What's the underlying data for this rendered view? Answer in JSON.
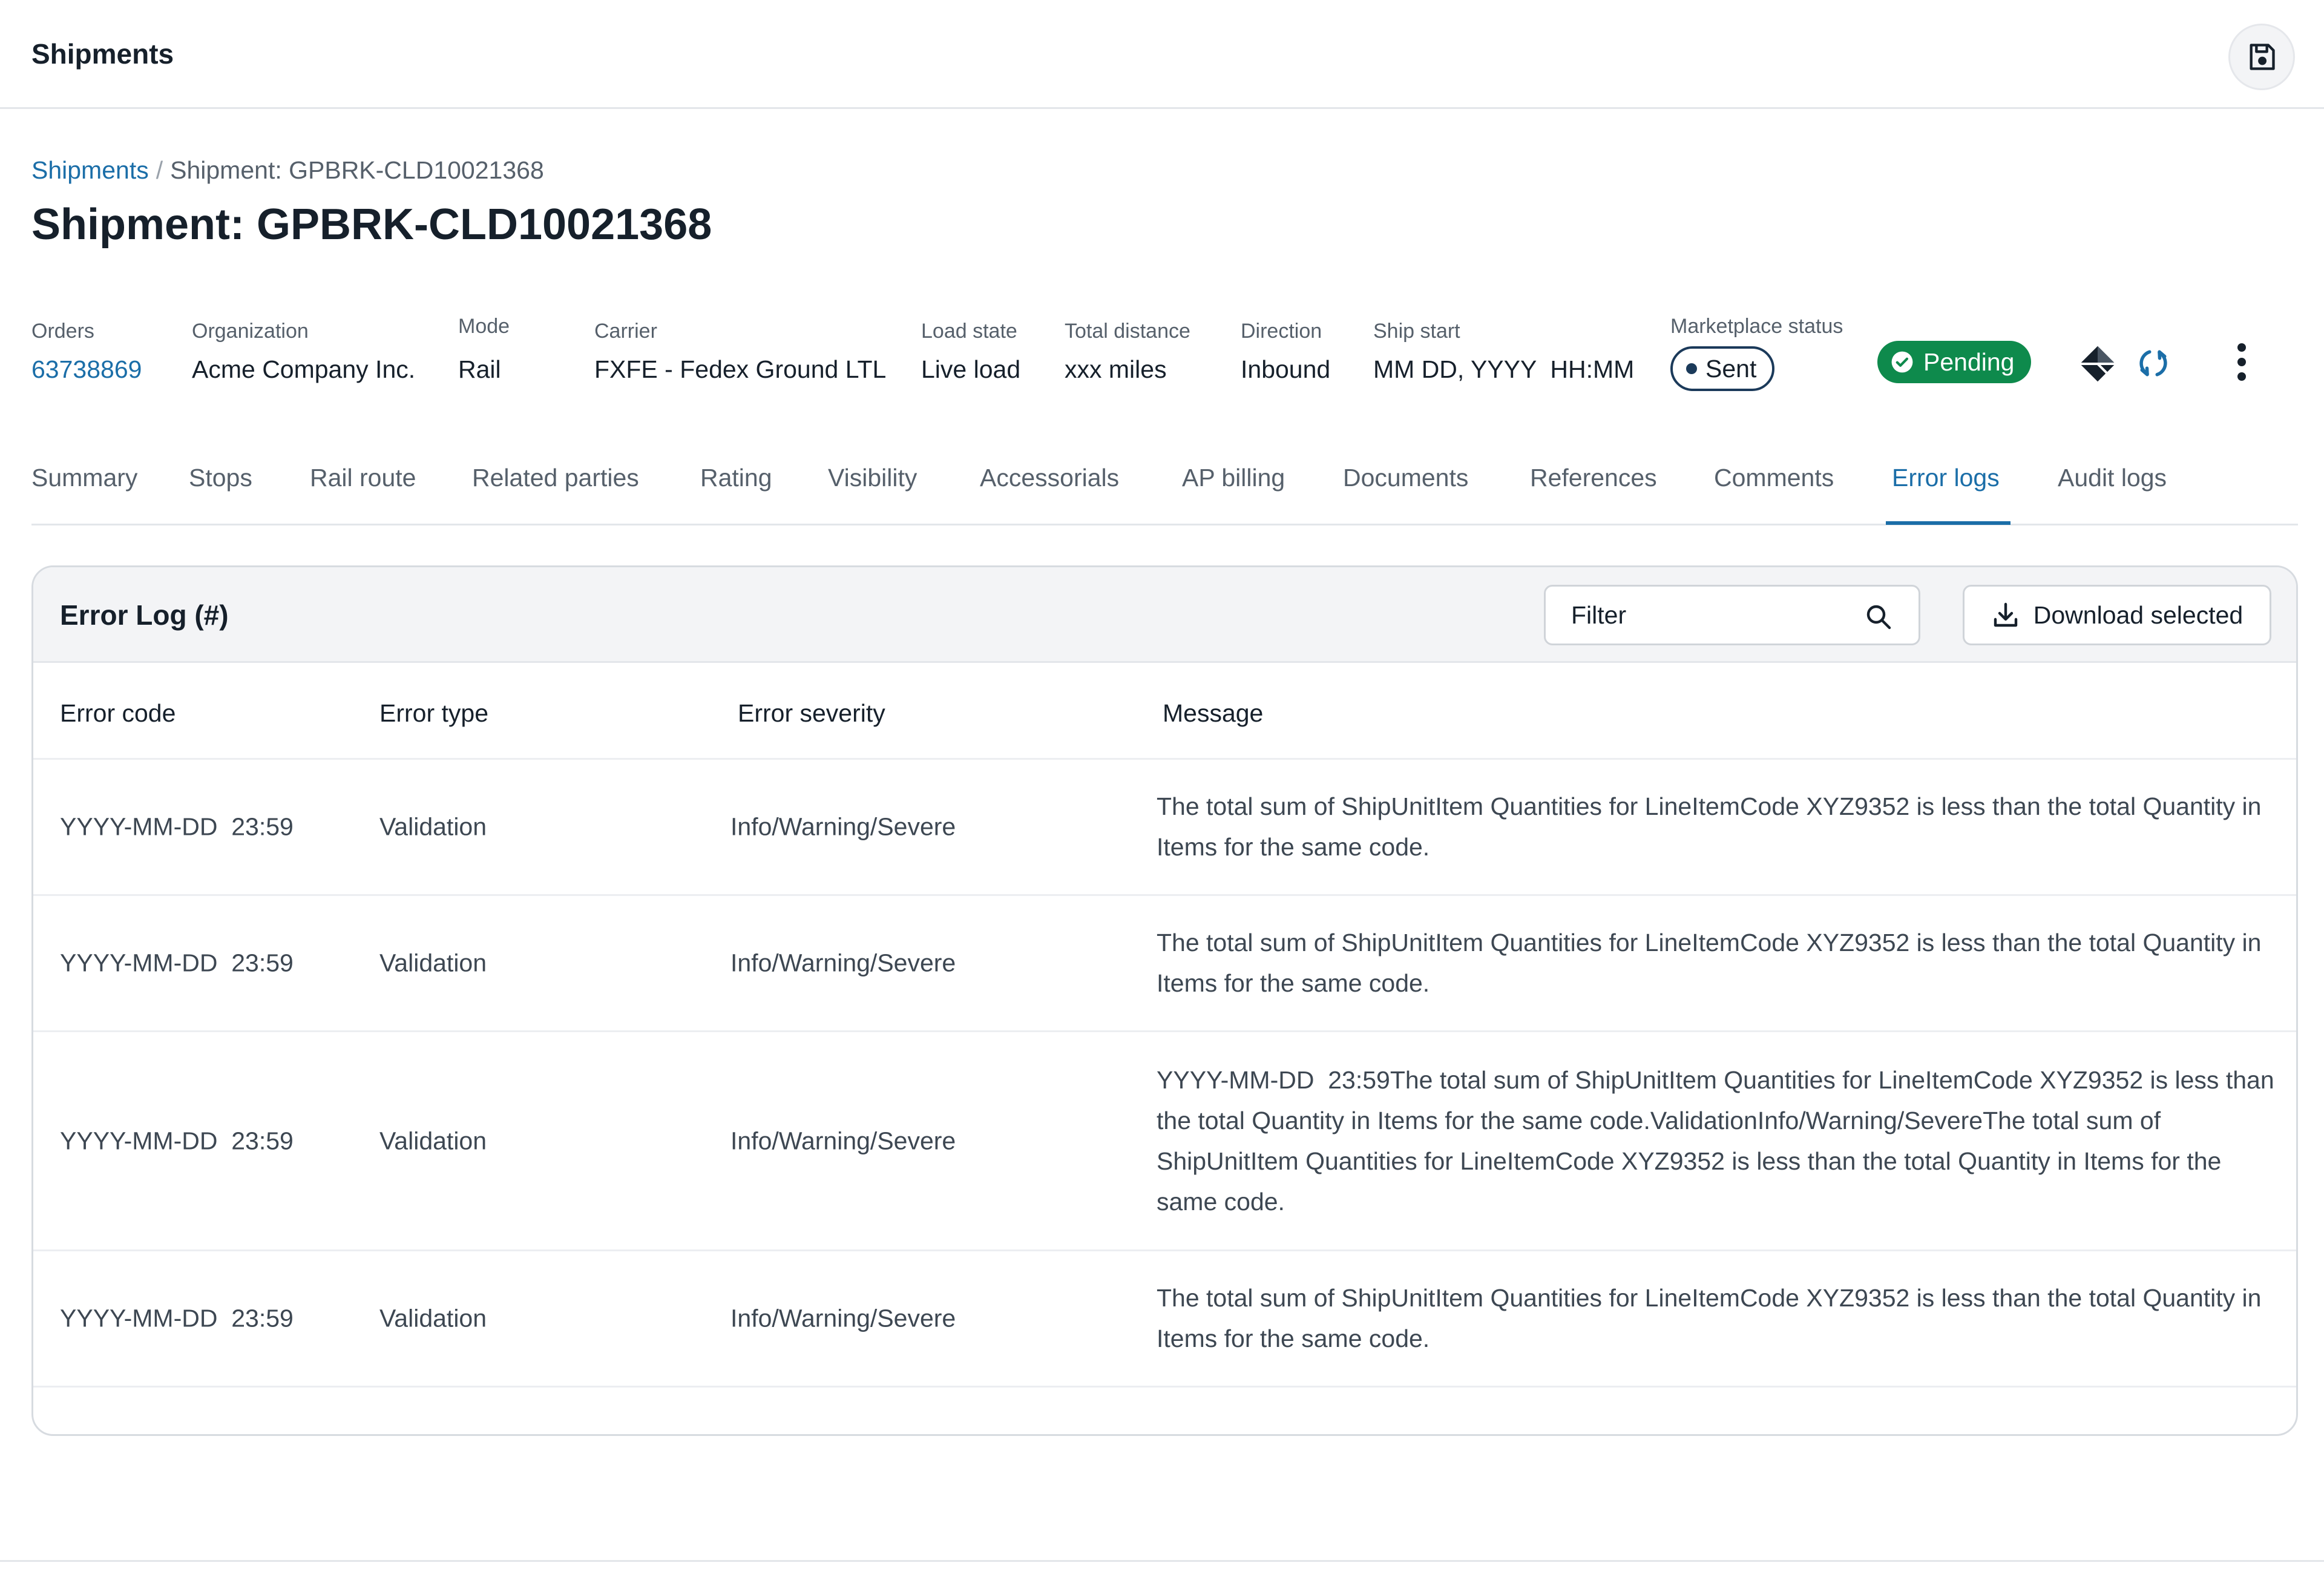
{
  "app": {
    "title": "Shipments"
  },
  "breadcrumb": {
    "root": "Shipments",
    "separator": "/",
    "current": "Shipment: GPBRK-CLD10021368"
  },
  "page": {
    "title": "Shipment: GPBRK-CLD10021368"
  },
  "meta": {
    "orders": {
      "label": "Orders",
      "value": "63738869"
    },
    "organization": {
      "label": "Organization",
      "value": "Acme Company Inc."
    },
    "mode": {
      "label": "Mode",
      "value": "Rail"
    },
    "carrier": {
      "label": "Carrier",
      "value": "FXFE - Fedex Ground LTL"
    },
    "load_state": {
      "label": "Load state",
      "value": "Live load"
    },
    "total_distance": {
      "label": "Total distance",
      "value": "xxx miles"
    },
    "direction": {
      "label": "Direction",
      "value": "Inbound"
    },
    "ship_start": {
      "label": "Ship start",
      "value": "MM DD, YYYY  HH:MM"
    },
    "marketplace_status": {
      "label": "Marketplace status",
      "value": "Sent"
    }
  },
  "status": {
    "label": "Pending",
    "color": "#0e8a4c"
  },
  "tabs": [
    {
      "label": "Summary"
    },
    {
      "label": "Stops"
    },
    {
      "label": "Rail route"
    },
    {
      "label": "Related parties"
    },
    {
      "label": "Rating"
    },
    {
      "label": "Visibility"
    },
    {
      "label": "Accessorials"
    },
    {
      "label": "AP billing"
    },
    {
      "label": "Documents"
    },
    {
      "label": "References"
    },
    {
      "label": "Comments"
    },
    {
      "label": "Error logs"
    },
    {
      "label": "Audit logs"
    }
  ],
  "active_tab": "Error logs",
  "error_log": {
    "title": "Error Log (#)",
    "filter_placeholder": "Filter",
    "download_label": "Download selected",
    "columns": [
      "Error code",
      "Error type",
      "Error severity",
      "Message"
    ],
    "rows": [
      {
        "code": "YYYY-MM-DD  23:59",
        "type": "Validation",
        "severity": "Info/Warning/Severe",
        "message": "The total sum of ShipUnitItem Quantities for LineItemCode XYZ9352 is less than the total Quantity in Items for the same code."
      },
      {
        "code": "YYYY-MM-DD  23:59",
        "type": "Validation",
        "severity": "Info/Warning/Severe",
        "message": "The total sum of ShipUnitItem Quantities for LineItemCode XYZ9352 is less than the total Quantity in Items for the same code."
      },
      {
        "code": "YYYY-MM-DD  23:59",
        "type": "Validation",
        "severity": "Info/Warning/Severe",
        "message": "YYYY-MM-DD  23:59The total sum of ShipUnitItem Quantities for LineItemCode XYZ9352 is less than the total Quantity in Items for the same code.ValidationInfo/Warning/SevereThe total sum of ShipUnitItem Quantities for LineItemCode XYZ9352 is less than the total Quantity in Items for the same code."
      },
      {
        "code": "YYYY-MM-DD  23:59",
        "type": "Validation",
        "severity": "Info/Warning/Severe",
        "message": "The total sum of ShipUnitItem Quantities for LineItemCode XYZ9352 is less than the total Quantity in Items for the same code."
      }
    ]
  },
  "colors": {
    "accent": "#1b6ea8",
    "text": "#16202b",
    "muted": "#56606b",
    "border": "#d7dbe0",
    "header_bg": "#f3f4f6"
  },
  "icons": {
    "save": "save-icon",
    "pending": "check-circle-icon",
    "marketplace": "diamond-logo-icon",
    "sync": "sync-icon",
    "more": "more-vertical-icon",
    "filter": "search-icon",
    "download": "download-icon"
  }
}
